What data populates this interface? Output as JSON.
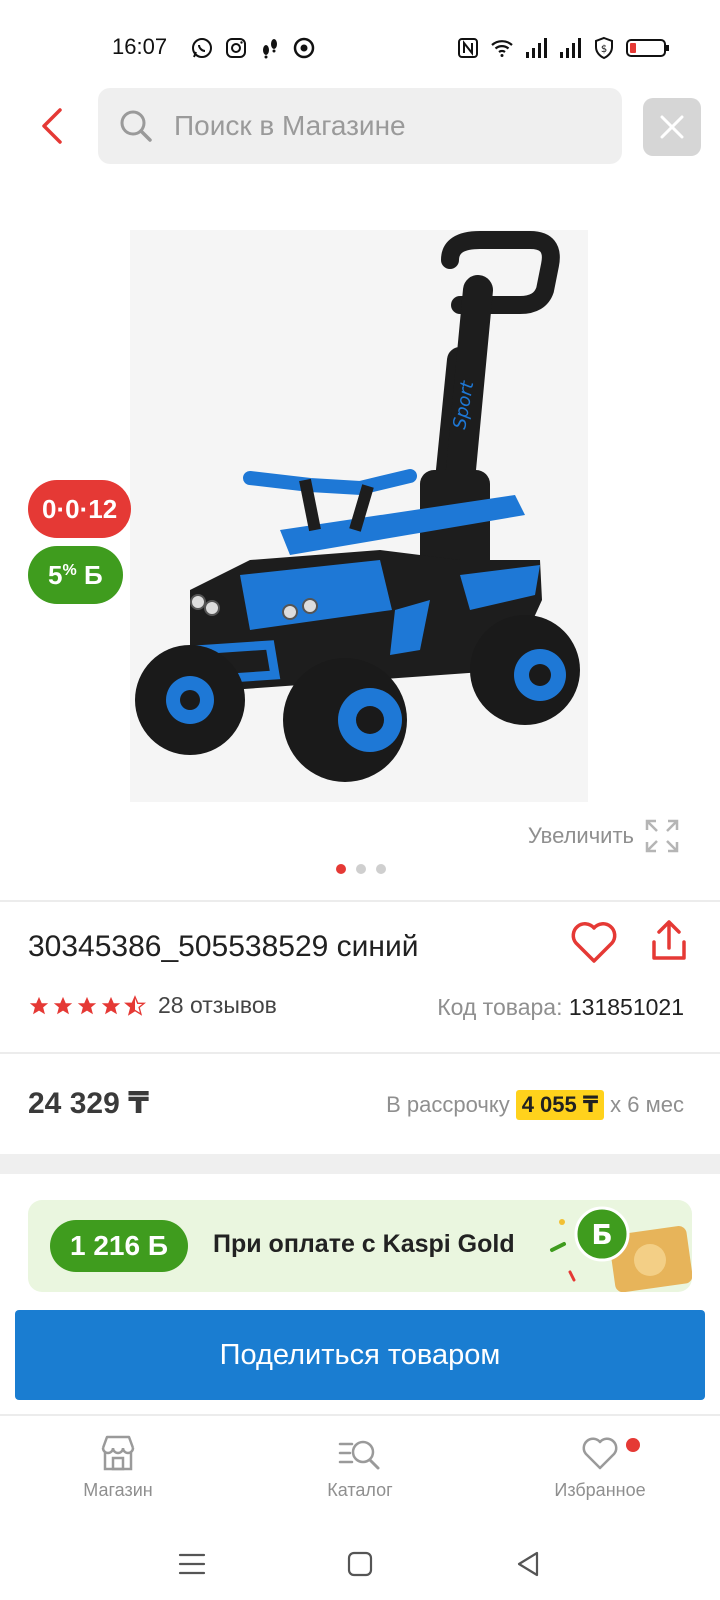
{
  "status_bar": {
    "time": "16:07",
    "left_icons": [
      "whatsapp-icon",
      "instagram-icon",
      "footsteps-icon",
      "chrome-icon"
    ],
    "right_icons": [
      "nfc-icon",
      "wifi-icon",
      "signal-icon",
      "signal-icon",
      "shield-icon",
      "battery-low-icon"
    ]
  },
  "top_bar": {
    "search_placeholder": "Поиск в Магазине"
  },
  "gallery": {
    "badge_installment": "0·0·12",
    "badge_bonus_value": "5",
    "badge_bonus_suffix": "%",
    "badge_bonus_currency": "Б",
    "zoom_label": "Увеличить",
    "slides_total": 3,
    "slide_active": 1
  },
  "product": {
    "title": "30345386_505538529 синий",
    "rating": 4.5,
    "reviews_label": "28 отзывов",
    "code_label": "Код товара:",
    "code_value": "131851021"
  },
  "price": {
    "value": "24 329 ₸",
    "installment_prefix": "В рассрочку",
    "installment_amount": "4 055 ₸",
    "installment_suffix": "х 6 мес"
  },
  "kaspi_gold": {
    "bonus": "1 216 Б",
    "text": "При оплате с Kaspi Gold"
  },
  "actions": {
    "share_label": "Поделиться товаром"
  },
  "bottom_nav": {
    "items": [
      {
        "label": "Магазин",
        "icon": "store-icon"
      },
      {
        "label": "Каталог",
        "icon": "catalog-search-icon"
      },
      {
        "label": "Избранное",
        "icon": "heart-icon",
        "has_badge": true
      }
    ]
  },
  "colors": {
    "accent_red": "#e53935",
    "bonus_green": "#3f9c1e",
    "button_blue": "#1a7dd1",
    "installment_yellow": "#ffd21c"
  }
}
